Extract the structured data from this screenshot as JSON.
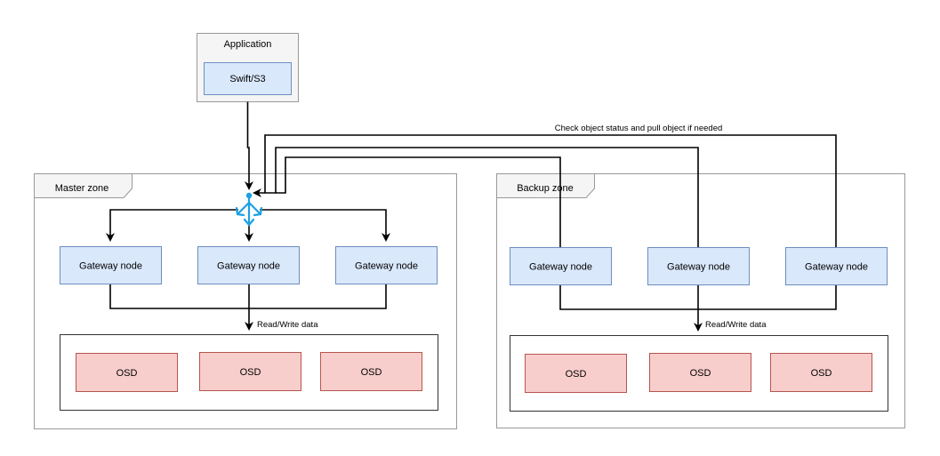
{
  "application": {
    "title": "Application",
    "protocol": "Swift/S3"
  },
  "zones": [
    {
      "name": "Master zone",
      "gateways": [
        "Gateway node",
        "Gateway node",
        "Gateway node"
      ],
      "storage_edge_label": "Read/Write data",
      "osds": [
        "OSD",
        "OSD",
        "OSD"
      ]
    },
    {
      "name": "Backup zone",
      "gateways": [
        "Gateway node",
        "Gateway node",
        "Gateway node"
      ],
      "storage_edge_label": "Read/Write data",
      "osds": [
        "OSD",
        "OSD",
        "OSD"
      ]
    }
  ],
  "sync_edge_label": "Check object status and pull object if needed",
  "colors": {
    "gateway_fill": "#dae8fc",
    "gateway_stroke": "#6c8ebf",
    "osd_fill": "#f8cecc",
    "osd_stroke": "#b85450",
    "zone_tab_fill": "#f5f5f5",
    "zone_stroke": "#999999",
    "app_fill": "#f5f5f5",
    "load_balancer": "#1ba1e2"
  }
}
